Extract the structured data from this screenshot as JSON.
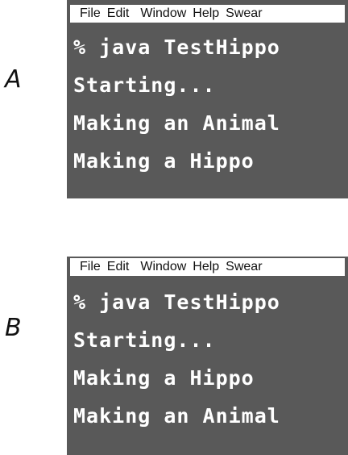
{
  "panels": [
    {
      "letter": "A",
      "menu": [
        "File",
        "Edit",
        "Window",
        "Help",
        "Swear"
      ],
      "lines": [
        "% java TestHippo",
        "Starting...",
        "Making an Animal",
        "Making a Hippo"
      ]
    },
    {
      "letter": "B",
      "menu": [
        "File",
        "Edit",
        "Window",
        "Help",
        "Swear"
      ],
      "lines": [
        "% java TestHippo",
        "Starting...",
        "Making a Hippo",
        "Making an Animal"
      ]
    }
  ],
  "colors": {
    "terminal_bg": "#595959",
    "menubar_bg": "#ffffff",
    "text": "#ffffff"
  }
}
